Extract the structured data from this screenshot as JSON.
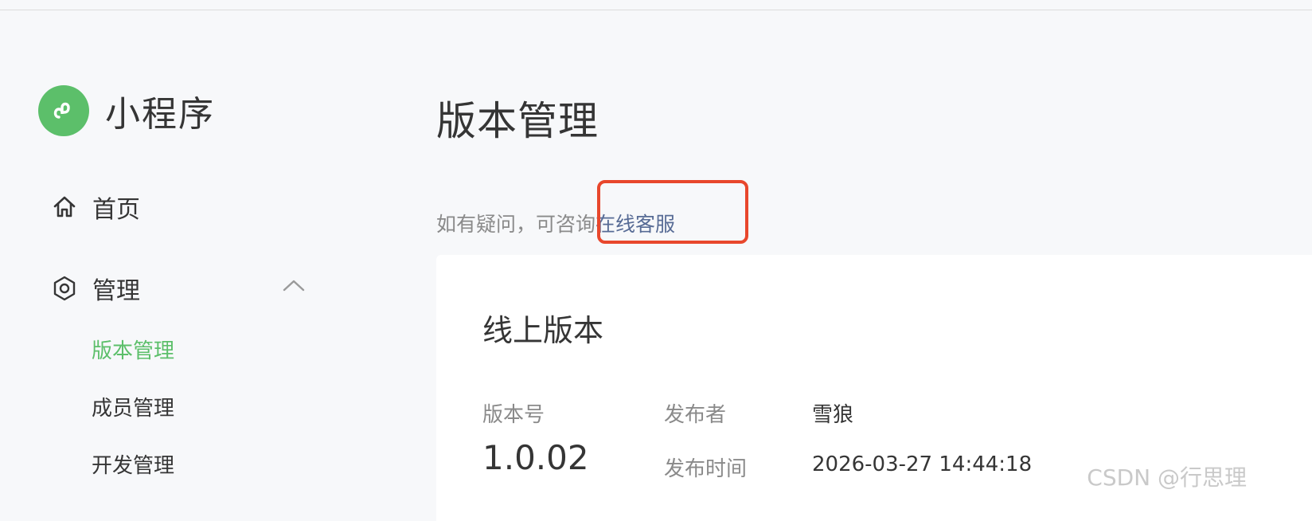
{
  "sidebar": {
    "brand": "小程序",
    "nav": {
      "home": "首页",
      "manage": "管理"
    },
    "submenu": [
      {
        "label": "版本管理",
        "active": true
      },
      {
        "label": "成员管理",
        "active": false
      },
      {
        "label": "开发管理",
        "active": false
      }
    ]
  },
  "main": {
    "title": "版本管理",
    "help_text": "如有疑问，可咨询",
    "help_link": "在线客服",
    "card": {
      "title": "线上版本",
      "version_label": "版本号",
      "version_value": "1.0.02",
      "publisher_label": "发布者",
      "publisher_value": "雪狼",
      "time_label": "发布时间",
      "time_value": "2026-03-27 14:44:18"
    }
  },
  "watermark": "CSDN @行思理",
  "colors": {
    "accent": "#5cbf6a",
    "link": "#576b95",
    "highlight": "#e8472c"
  },
  "icons": {
    "brand": "mini-program-logo-icon",
    "home": "home-icon",
    "manage": "hexagon-settings-icon",
    "collapse": "chevron-up-icon"
  }
}
